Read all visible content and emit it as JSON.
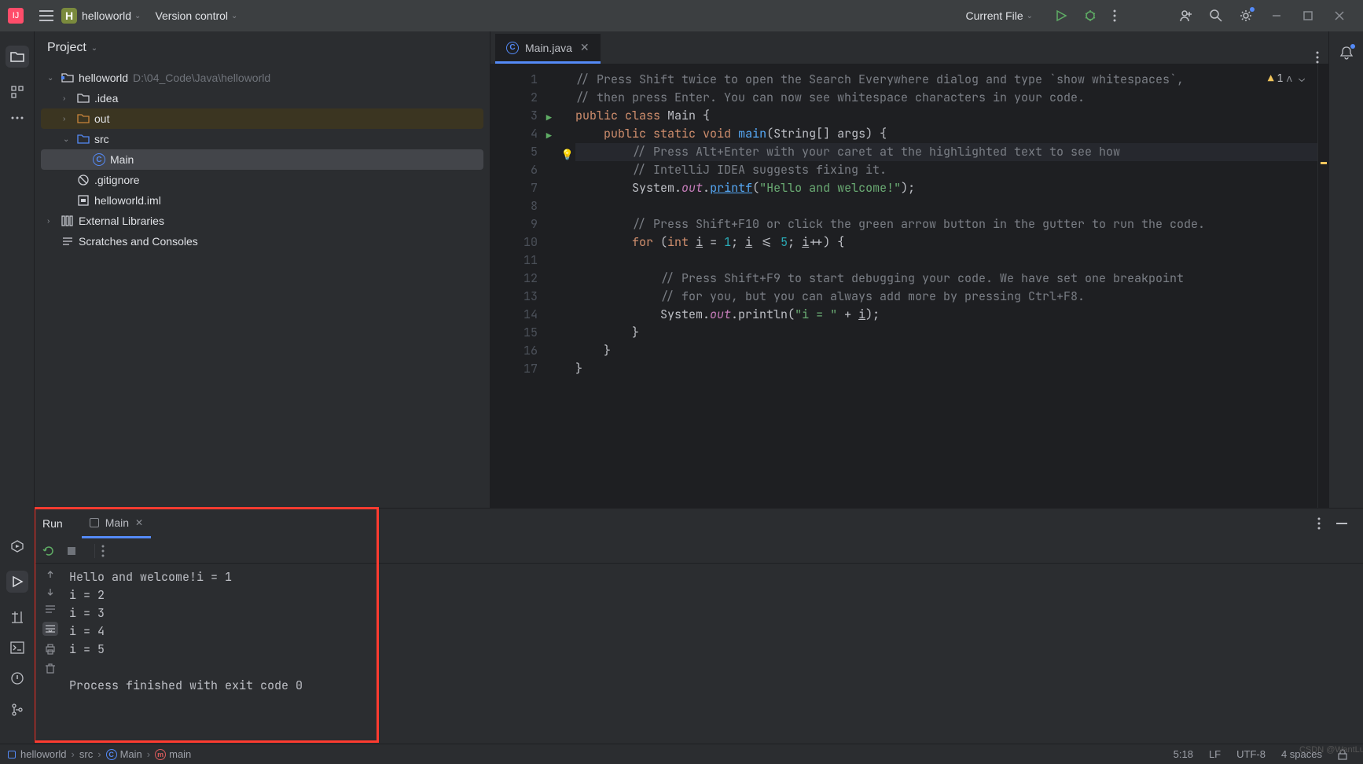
{
  "titlebar": {
    "project_letter": "H",
    "project_name": "helloworld",
    "vcs_label": "Version control",
    "run_target": "Current File"
  },
  "project_panel": {
    "title": "Project",
    "root": {
      "name": "helloworld",
      "path": "D:\\04_Code\\Java\\helloworld"
    },
    "idea": ".idea",
    "out": "out",
    "src": "src",
    "main": "Main",
    "gitignore": ".gitignore",
    "iml": "helloworld.iml",
    "ext_lib": "External Libraries",
    "scratches": "Scratches and Consoles"
  },
  "editor": {
    "tab_name": "Main.java",
    "warn_count": "1",
    "lines": {
      "l1a": "// Press Shift twice to open the Search Everywhere dialog and type `show whitespaces`,",
      "l2": "// then press Enter. You can now see whitespace characters in your code.",
      "l3_public": "public ",
      "l3_class": "class ",
      "l3_name": "Main {",
      "l4_pub": "public ",
      "l4_static": "static ",
      "l4_void": "void ",
      "l4_main": "main",
      "l4_rest": "(String[] args) {",
      "l5": "// Press Alt+Enter with your caret at the highlighted text to see how",
      "l6": "// IntelliJ IDEA suggests fixing it.",
      "l7_sys": "System.",
      "l7_out": "out",
      "l7_dot": ".",
      "l7_printf": "printf",
      "l7_str": "\"Hello and welcome!\"",
      "l7_end": ");",
      "l9": "// Press Shift+F10 or click the green arrow button in the gutter to run the code.",
      "l10_for": "for ",
      "l10_int": "int ",
      "l10_i1": "i",
      "l10_eq": " = ",
      "l10_1": "1",
      "l10_sc": "; ",
      "l10_i2": "i",
      "l10_le": " <= ",
      "l10_5": "5",
      "l10_sc2": "; ",
      "l10_i3": "i",
      "l10_pp": "++) {",
      "l12": "// Press Shift+F9 to start debugging your code. We have set one breakpoint",
      "l13": "// for you, but you can always add more by pressing Ctrl+F8.",
      "l14_sys": "System.",
      "l14_out": "out",
      "l14_pl": ".println(",
      "l14_str": "\"i = \"",
      "l14_plus": " + ",
      "l14_i": "i",
      "l14_end": ");",
      "l15": "}",
      "l16": "}",
      "l17": "}"
    },
    "numbers": [
      "1",
      "2",
      "3",
      "4",
      "5",
      "6",
      "7",
      "8",
      "9",
      "10",
      "11",
      "12",
      "13",
      "14",
      "15",
      "16",
      "17"
    ]
  },
  "run": {
    "title": "Run",
    "tab": "Main",
    "output": [
      "Hello and welcome!i = 1",
      "i = 2",
      "i = 3",
      "i = 4",
      "i = 5",
      "",
      "Process finished with exit code 0"
    ]
  },
  "statusbar": {
    "crumb1": "helloworld",
    "crumb2": "src",
    "crumb3": "Main",
    "crumb4": "main",
    "pos": "5:18",
    "sep": "LF",
    "enc": "UTF-8",
    "indent": "4 spaces",
    "watermark": "CSDN @WantLuo"
  }
}
